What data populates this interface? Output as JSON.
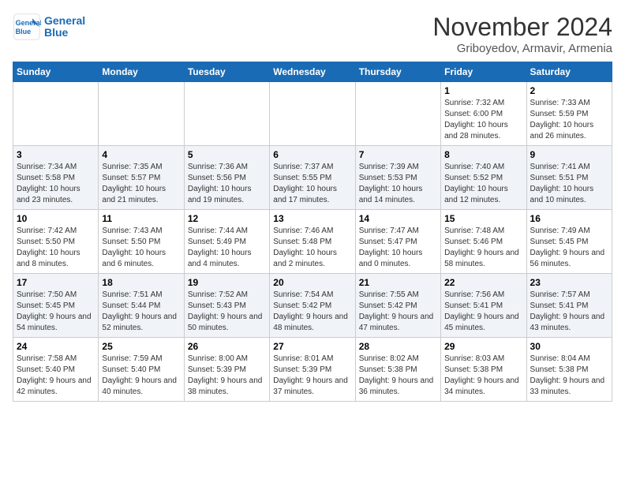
{
  "header": {
    "logo_line1": "General",
    "logo_line2": "Blue",
    "month": "November 2024",
    "location": "Griboyedov, Armavir, Armenia"
  },
  "weekdays": [
    "Sunday",
    "Monday",
    "Tuesday",
    "Wednesday",
    "Thursday",
    "Friday",
    "Saturday"
  ],
  "weeks": [
    [
      {
        "day": "",
        "info": ""
      },
      {
        "day": "",
        "info": ""
      },
      {
        "day": "",
        "info": ""
      },
      {
        "day": "",
        "info": ""
      },
      {
        "day": "",
        "info": ""
      },
      {
        "day": "1",
        "info": "Sunrise: 7:32 AM\nSunset: 6:00 PM\nDaylight: 10 hours and 28 minutes."
      },
      {
        "day": "2",
        "info": "Sunrise: 7:33 AM\nSunset: 5:59 PM\nDaylight: 10 hours and 26 minutes."
      }
    ],
    [
      {
        "day": "3",
        "info": "Sunrise: 7:34 AM\nSunset: 5:58 PM\nDaylight: 10 hours and 23 minutes."
      },
      {
        "day": "4",
        "info": "Sunrise: 7:35 AM\nSunset: 5:57 PM\nDaylight: 10 hours and 21 minutes."
      },
      {
        "day": "5",
        "info": "Sunrise: 7:36 AM\nSunset: 5:56 PM\nDaylight: 10 hours and 19 minutes."
      },
      {
        "day": "6",
        "info": "Sunrise: 7:37 AM\nSunset: 5:55 PM\nDaylight: 10 hours and 17 minutes."
      },
      {
        "day": "7",
        "info": "Sunrise: 7:39 AM\nSunset: 5:53 PM\nDaylight: 10 hours and 14 minutes."
      },
      {
        "day": "8",
        "info": "Sunrise: 7:40 AM\nSunset: 5:52 PM\nDaylight: 10 hours and 12 minutes."
      },
      {
        "day": "9",
        "info": "Sunrise: 7:41 AM\nSunset: 5:51 PM\nDaylight: 10 hours and 10 minutes."
      }
    ],
    [
      {
        "day": "10",
        "info": "Sunrise: 7:42 AM\nSunset: 5:50 PM\nDaylight: 10 hours and 8 minutes."
      },
      {
        "day": "11",
        "info": "Sunrise: 7:43 AM\nSunset: 5:50 PM\nDaylight: 10 hours and 6 minutes."
      },
      {
        "day": "12",
        "info": "Sunrise: 7:44 AM\nSunset: 5:49 PM\nDaylight: 10 hours and 4 minutes."
      },
      {
        "day": "13",
        "info": "Sunrise: 7:46 AM\nSunset: 5:48 PM\nDaylight: 10 hours and 2 minutes."
      },
      {
        "day": "14",
        "info": "Sunrise: 7:47 AM\nSunset: 5:47 PM\nDaylight: 10 hours and 0 minutes."
      },
      {
        "day": "15",
        "info": "Sunrise: 7:48 AM\nSunset: 5:46 PM\nDaylight: 9 hours and 58 minutes."
      },
      {
        "day": "16",
        "info": "Sunrise: 7:49 AM\nSunset: 5:45 PM\nDaylight: 9 hours and 56 minutes."
      }
    ],
    [
      {
        "day": "17",
        "info": "Sunrise: 7:50 AM\nSunset: 5:45 PM\nDaylight: 9 hours and 54 minutes."
      },
      {
        "day": "18",
        "info": "Sunrise: 7:51 AM\nSunset: 5:44 PM\nDaylight: 9 hours and 52 minutes."
      },
      {
        "day": "19",
        "info": "Sunrise: 7:52 AM\nSunset: 5:43 PM\nDaylight: 9 hours and 50 minutes."
      },
      {
        "day": "20",
        "info": "Sunrise: 7:54 AM\nSunset: 5:42 PM\nDaylight: 9 hours and 48 minutes."
      },
      {
        "day": "21",
        "info": "Sunrise: 7:55 AM\nSunset: 5:42 PM\nDaylight: 9 hours and 47 minutes."
      },
      {
        "day": "22",
        "info": "Sunrise: 7:56 AM\nSunset: 5:41 PM\nDaylight: 9 hours and 45 minutes."
      },
      {
        "day": "23",
        "info": "Sunrise: 7:57 AM\nSunset: 5:41 PM\nDaylight: 9 hours and 43 minutes."
      }
    ],
    [
      {
        "day": "24",
        "info": "Sunrise: 7:58 AM\nSunset: 5:40 PM\nDaylight: 9 hours and 42 minutes."
      },
      {
        "day": "25",
        "info": "Sunrise: 7:59 AM\nSunset: 5:40 PM\nDaylight: 9 hours and 40 minutes."
      },
      {
        "day": "26",
        "info": "Sunrise: 8:00 AM\nSunset: 5:39 PM\nDaylight: 9 hours and 38 minutes."
      },
      {
        "day": "27",
        "info": "Sunrise: 8:01 AM\nSunset: 5:39 PM\nDaylight: 9 hours and 37 minutes."
      },
      {
        "day": "28",
        "info": "Sunrise: 8:02 AM\nSunset: 5:38 PM\nDaylight: 9 hours and 36 minutes."
      },
      {
        "day": "29",
        "info": "Sunrise: 8:03 AM\nSunset: 5:38 PM\nDaylight: 9 hours and 34 minutes."
      },
      {
        "day": "30",
        "info": "Sunrise: 8:04 AM\nSunset: 5:38 PM\nDaylight: 9 hours and 33 minutes."
      }
    ]
  ]
}
